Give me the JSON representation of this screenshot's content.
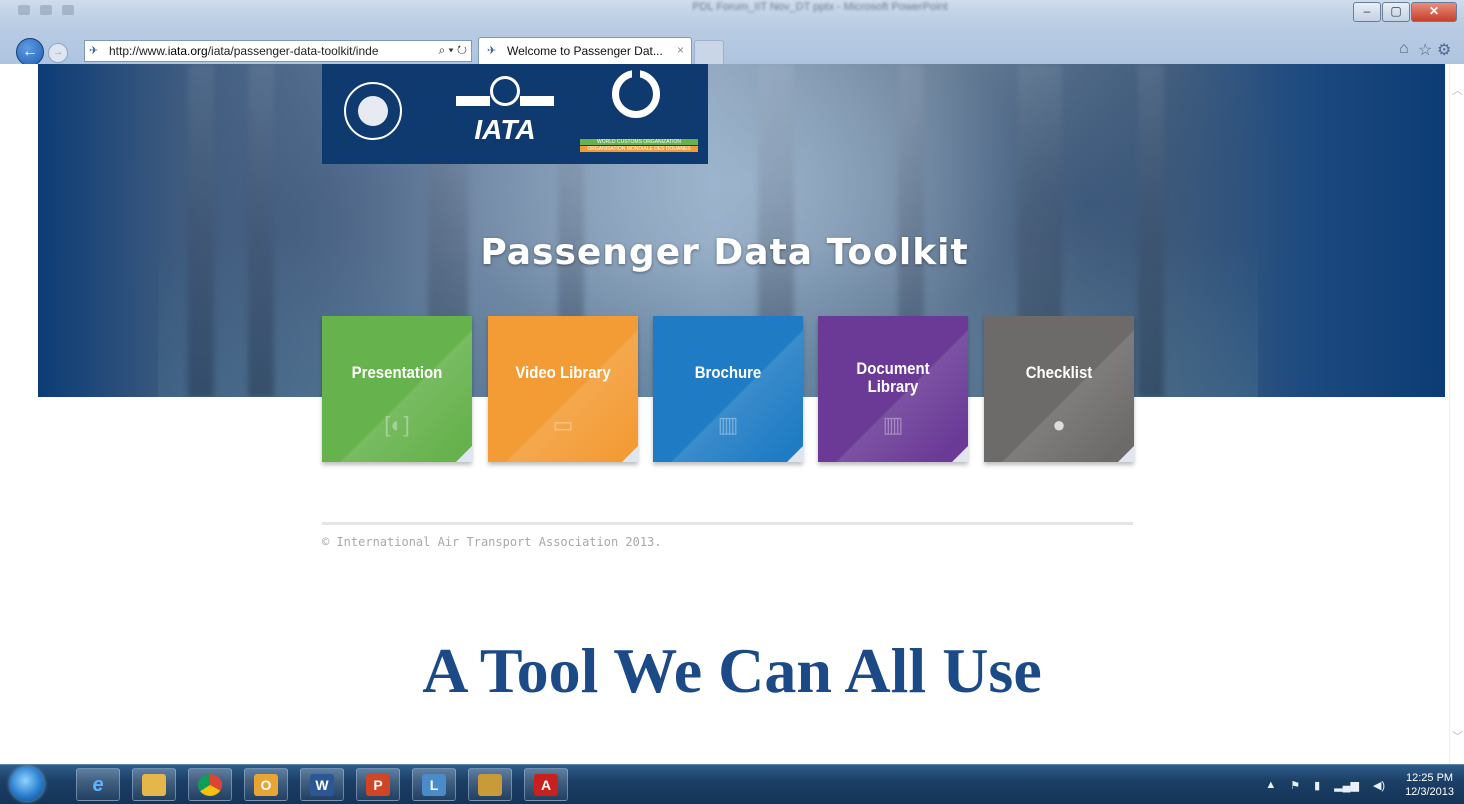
{
  "window": {
    "title": "PDL Forum_IIT Nov_DT pptx - Microsoft PowerPoint"
  },
  "browser": {
    "address": "http://www.iata.org/iata/passenger-data-toolkit/inde",
    "address_domain": "iata.org",
    "address_prefix": "http://www.",
    "address_suffix": "/iata/passenger-data-toolkit/inde",
    "tab_title": "Welcome to Passenger Dat...",
    "tab_close": "×",
    "search_glyph": "⌕ ▾ ↻"
  },
  "logos": {
    "wco_line1": "WORLD CUSTOMS ORGANIZATION",
    "wco_line2": "ORGANISATION MONDIALE DES DOUANES",
    "iata_word": "IATA"
  },
  "page": {
    "title": "Passenger Data Toolkit",
    "tiles": [
      {
        "label": "Presentation",
        "icon": "presentation-icon",
        "color": "#66b24c"
      },
      {
        "label": "Video Library",
        "icon": "video-icon",
        "color": "#f39c36"
      },
      {
        "label": "Brochure",
        "icon": "map-icon",
        "color": "#1f7cc4"
      },
      {
        "label": "Document Library",
        "icon": "library-icon",
        "color": "#6a3a96"
      },
      {
        "label": "Checklist",
        "icon": "circle-icon",
        "color": "#6d6b6a"
      }
    ],
    "copyright": "© International Air Transport Association 2013."
  },
  "slide": {
    "caption": "A Tool We Can All Use"
  },
  "taskbar": {
    "apps": [
      "IE",
      "Explorer",
      "Chrome",
      "Outlook",
      "Word",
      "PowerPoint",
      "Lync",
      "Archive",
      "Acrobat"
    ],
    "time": "12:25 PM",
    "date": "12/3/2013"
  }
}
